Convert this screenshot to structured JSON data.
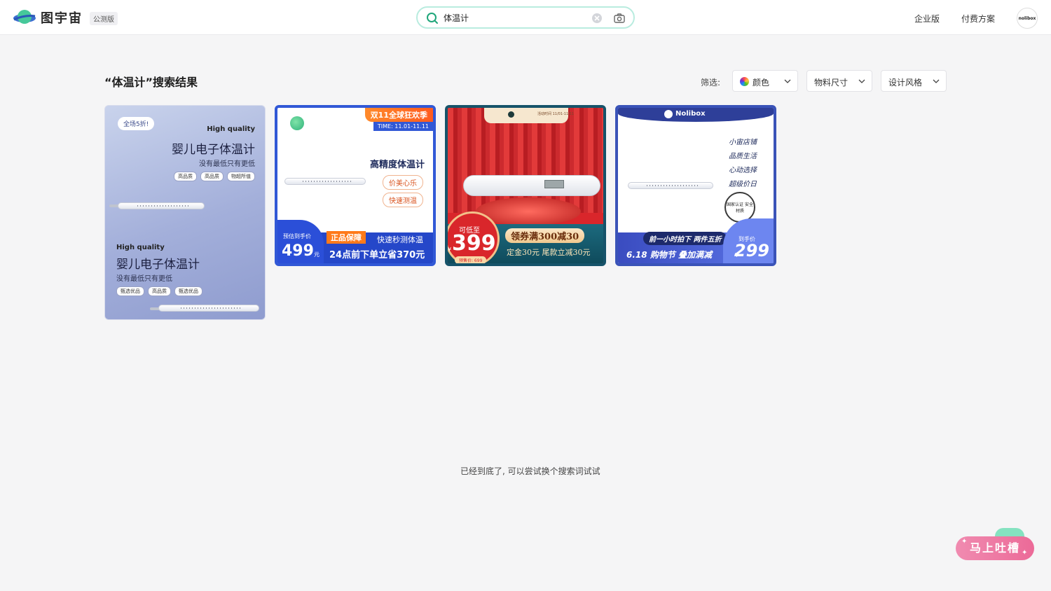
{
  "header": {
    "logo_text": "图宇宙",
    "badge": "公测版",
    "search": {
      "value": "体温计",
      "placeholder": ""
    },
    "nav": {
      "enterprise": "企业版",
      "pricing": "付费方案"
    },
    "avatar_text": "nolibox"
  },
  "results": {
    "title": "“体温计”搜索结果",
    "filter_label": "筛选:",
    "filters": [
      "颜色",
      "物料尺寸",
      "设计风格"
    ]
  },
  "cards": [
    {
      "pill": "全场5折!",
      "hq": "High quality",
      "title": "婴儿电子体温计",
      "sub": "没有最低只有更低",
      "tags_top": [
        "高品质",
        "高品质",
        "物超所值"
      ],
      "hq2": "High quality",
      "title2": "婴儿电子体温计",
      "sub2": "没有最低只有更低",
      "tags_bottom": [
        "甄选优品",
        "高品质",
        "甄选优品"
      ]
    },
    {
      "ribbon": "双11全球狂欢季",
      "time": "TIME: 11.01-11.11",
      "heading": "高精度体温计",
      "chips": [
        "价美心乐",
        "快速测温"
      ],
      "price_label": "预估到手价",
      "price": "499",
      "price_unit": "元",
      "guarantee": "正品保障",
      "fast": "快速秒测体温",
      "save": "24点前下单立省370元"
    },
    {
      "header_text": "活动时间 11/01-11/11",
      "can": "可低至",
      "yen": "¥",
      "price": "399",
      "presale": "预售价: 699",
      "coupon": "领券满300减30",
      "deposit": "定金30元 尾款立减30元"
    },
    {
      "brand": "Nolibox",
      "lines": [
        "小宙店铺",
        "品质生活",
        "心动选择",
        "超级价日"
      ],
      "badge": "国家认证 安全材质",
      "tag": "前一小时拍下 两件五折",
      "event": "6.18 购物节  叠加满减",
      "price_label": "到手价",
      "yen": "¥",
      "price": "299"
    }
  ],
  "end_text": "已经到底了, 可以尝试换个搜索词试试",
  "feedback": "马上吐槽",
  "colors": {
    "accent": "#b9ecdf",
    "feedback": "#ec6a98"
  }
}
